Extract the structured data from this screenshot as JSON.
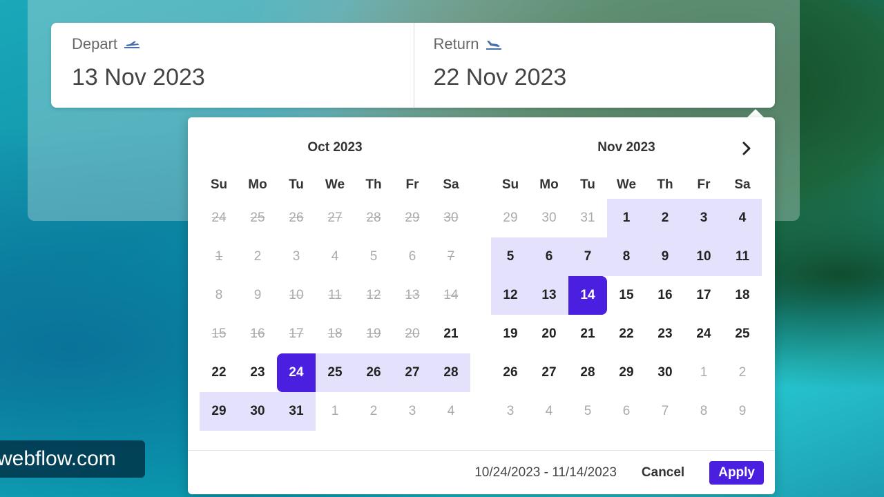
{
  "depart": {
    "label": "Depart",
    "value": "13 Nov 2023"
  },
  "return": {
    "label": "Return",
    "value": "22 Nov 2023"
  },
  "calendar": {
    "weekdays": [
      "Su",
      "Mo",
      "Tu",
      "We",
      "Th",
      "Fr",
      "Sa"
    ],
    "months": [
      {
        "title": "Oct 2023",
        "weeks": [
          [
            {
              "d": "24",
              "s": "struck"
            },
            {
              "d": "25",
              "s": "struck"
            },
            {
              "d": "26",
              "s": "struck"
            },
            {
              "d": "27",
              "s": "struck"
            },
            {
              "d": "28",
              "s": "struck"
            },
            {
              "d": "29",
              "s": "struck"
            },
            {
              "d": "30",
              "s": "struck"
            }
          ],
          [
            {
              "d": "1",
              "s": "struck"
            },
            {
              "d": "2",
              "s": "muted"
            },
            {
              "d": "3",
              "s": "muted"
            },
            {
              "d": "4",
              "s": "muted"
            },
            {
              "d": "5",
              "s": "muted"
            },
            {
              "d": "6",
              "s": "muted"
            },
            {
              "d": "7",
              "s": "struck"
            }
          ],
          [
            {
              "d": "8",
              "s": "muted"
            },
            {
              "d": "9",
              "s": "muted"
            },
            {
              "d": "10",
              "s": "struck"
            },
            {
              "d": "11",
              "s": "struck"
            },
            {
              "d": "12",
              "s": "struck"
            },
            {
              "d": "13",
              "s": "struck"
            },
            {
              "d": "14",
              "s": "struck"
            }
          ],
          [
            {
              "d": "15",
              "s": "struck"
            },
            {
              "d": "16",
              "s": "struck"
            },
            {
              "d": "17",
              "s": "struck"
            },
            {
              "d": "18",
              "s": "struck"
            },
            {
              "d": "19",
              "s": "struck"
            },
            {
              "d": "20",
              "s": "struck"
            },
            {
              "d": "21",
              "s": "normal"
            }
          ],
          [
            {
              "d": "22",
              "s": "normal"
            },
            {
              "d": "23",
              "s": "normal"
            },
            {
              "d": "24",
              "s": "sel start"
            },
            {
              "d": "25",
              "s": "range"
            },
            {
              "d": "26",
              "s": "range"
            },
            {
              "d": "27",
              "s": "range"
            },
            {
              "d": "28",
              "s": "range"
            }
          ],
          [
            {
              "d": "29",
              "s": "range"
            },
            {
              "d": "30",
              "s": "range"
            },
            {
              "d": "31",
              "s": "range"
            },
            {
              "d": "1",
              "s": "muted"
            },
            {
              "d": "2",
              "s": "muted"
            },
            {
              "d": "3",
              "s": "muted"
            },
            {
              "d": "4",
              "s": "muted"
            }
          ]
        ]
      },
      {
        "title": "Nov 2023",
        "weeks": [
          [
            {
              "d": "29",
              "s": "muted"
            },
            {
              "d": "30",
              "s": "muted"
            },
            {
              "d": "31",
              "s": "muted"
            },
            {
              "d": "1",
              "s": "range"
            },
            {
              "d": "2",
              "s": "range"
            },
            {
              "d": "3",
              "s": "range"
            },
            {
              "d": "4",
              "s": "range"
            }
          ],
          [
            {
              "d": "5",
              "s": "range"
            },
            {
              "d": "6",
              "s": "range"
            },
            {
              "d": "7",
              "s": "range"
            },
            {
              "d": "8",
              "s": "range"
            },
            {
              "d": "9",
              "s": "range"
            },
            {
              "d": "10",
              "s": "range"
            },
            {
              "d": "11",
              "s": "range"
            }
          ],
          [
            {
              "d": "12",
              "s": "range"
            },
            {
              "d": "13",
              "s": "range"
            },
            {
              "d": "14",
              "s": "sel end"
            },
            {
              "d": "15",
              "s": "normal"
            },
            {
              "d": "16",
              "s": "normal"
            },
            {
              "d": "17",
              "s": "normal"
            },
            {
              "d": "18",
              "s": "normal"
            }
          ],
          [
            {
              "d": "19",
              "s": "normal"
            },
            {
              "d": "20",
              "s": "normal"
            },
            {
              "d": "21",
              "s": "normal"
            },
            {
              "d": "22",
              "s": "normal"
            },
            {
              "d": "23",
              "s": "normal"
            },
            {
              "d": "24",
              "s": "normal"
            },
            {
              "d": "25",
              "s": "normal"
            }
          ],
          [
            {
              "d": "26",
              "s": "normal"
            },
            {
              "d": "27",
              "s": "normal"
            },
            {
              "d": "28",
              "s": "normal"
            },
            {
              "d": "29",
              "s": "normal"
            },
            {
              "d": "30",
              "s": "normal"
            },
            {
              "d": "1",
              "s": "muted"
            },
            {
              "d": "2",
              "s": "muted"
            }
          ],
          [
            {
              "d": "3",
              "s": "muted"
            },
            {
              "d": "4",
              "s": "muted"
            },
            {
              "d": "5",
              "s": "muted"
            },
            {
              "d": "6",
              "s": "muted"
            },
            {
              "d": "7",
              "s": "muted"
            },
            {
              "d": "8",
              "s": "muted"
            },
            {
              "d": "9",
              "s": "muted"
            }
          ]
        ]
      }
    ]
  },
  "footer": {
    "range_text": "10/24/2023 - 11/14/2023",
    "cancel_label": "Cancel",
    "apply_label": "Apply"
  },
  "watermark": "webflow.com",
  "colors": {
    "accent": "#4b1fe0",
    "range": "#e3e1fb"
  },
  "icons": {
    "depart": "plane-takeoff-icon",
    "return": "plane-landing-icon",
    "next": "chevron-right-icon"
  }
}
